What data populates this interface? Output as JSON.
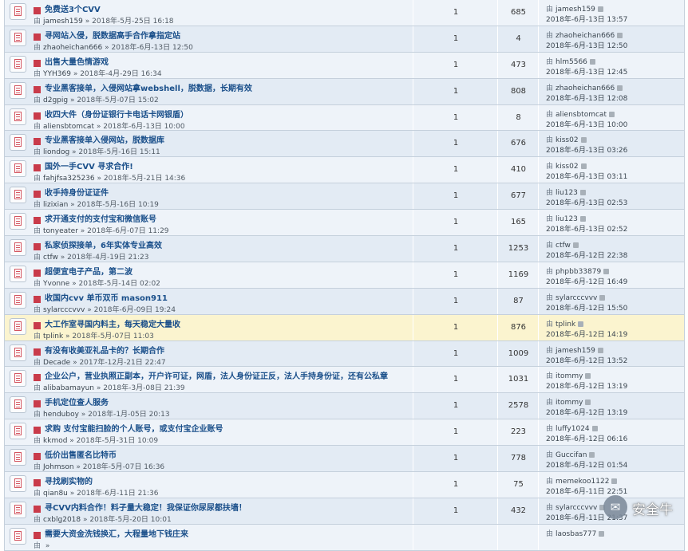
{
  "icons": {
    "topic": "topic-doc-icon",
    "bullet": "red-square-icon",
    "author": "author-icon",
    "last_author": "author-icon",
    "goto_last": "goto-last-post-icon"
  },
  "colors": {
    "title": "#1a4f8a",
    "row": "#eef3f9",
    "row_alt": "#e3ebf4",
    "row_sticky": "#fbf4cf",
    "bullet": "#c93b4a"
  },
  "author_marker": "由",
  "topics": [
    {
      "title": "免费送3个CVV",
      "author": "jamesh159",
      "date": "2018年-5月-25日 16:18",
      "replies": "1",
      "views": "685",
      "last_author": "jamesh159",
      "last_date": "2018年-6月-13日 13:57"
    },
    {
      "title": "寻网站入侵，脱数据高手合作拿指定站",
      "author": "zhaoheichan666",
      "date": "2018年-6月-13日 12:50",
      "replies": "1",
      "views": "4",
      "last_author": "zhaoheichan666",
      "last_date": "2018年-6月-13日 12:50"
    },
    {
      "title": "出售大量色情游戏",
      "author": "YYH369",
      "date": "2018年-4月-29日 16:34",
      "replies": "1",
      "views": "473",
      "last_author": "hlm5566",
      "last_date": "2018年-6月-13日 12:45"
    },
    {
      "title": "专业黑客接单，入侵网站拿webshell，脱数据，长期有效",
      "author": "d2gpig",
      "date": "2018年-5月-07日 15:02",
      "replies": "1",
      "views": "808",
      "last_author": "zhaoheichan666",
      "last_date": "2018年-6月-13日 12:08"
    },
    {
      "title": "收四大件（身份证银行卡电话卡网银盾）",
      "author": "aliensbtomcat",
      "date": "2018年-6月-13日 10:00",
      "replies": "1",
      "views": "8",
      "last_author": "aliensbtomcat",
      "last_date": "2018年-6月-13日 10:00"
    },
    {
      "title": "专业黑客接单入侵网站，脱数据库",
      "author": "liondog",
      "date": "2018年-5月-16日 15:11",
      "replies": "1",
      "views": "676",
      "last_author": "kiss02",
      "last_date": "2018年-6月-13日 03:26"
    },
    {
      "title": "国外一手CVV 寻求合作!",
      "author": "fahjfsa325236",
      "date": "2018年-5月-21日 14:36",
      "replies": "1",
      "views": "410",
      "last_author": "kiss02",
      "last_date": "2018年-6月-13日 03:11"
    },
    {
      "title": "收手持身份证证件",
      "author": "lizixian",
      "date": "2018年-5月-16日 10:19",
      "replies": "1",
      "views": "677",
      "last_author": "liu123",
      "last_date": "2018年-6月-13日 02:53"
    },
    {
      "title": "求开通支付的支付宝和微信账号",
      "author": "tonyeater",
      "date": "2018年-6月-07日 11:29",
      "replies": "1",
      "views": "165",
      "last_author": "liu123",
      "last_date": "2018年-6月-13日 02:52"
    },
    {
      "title": "私家侦探接单，6年实体专业高效",
      "author": "ctfw",
      "date": "2018年-4月-19日 21:23",
      "replies": "1",
      "views": "1253",
      "last_author": "ctfw",
      "last_date": "2018年-6月-12日 22:38"
    },
    {
      "title": "超便宜电子产品，第二波",
      "author": "Yvonne",
      "date": "2018年-5月-14日 02:02",
      "replies": "1",
      "views": "1169",
      "last_author": "phpbb33879",
      "last_date": "2018年-6月-12日 16:49"
    },
    {
      "title": "收国内cvv 单币双币 mason911",
      "author": "sylarcccvvv",
      "date": "2018年-6月-09日 19:24",
      "replies": "1",
      "views": "87",
      "last_author": "sylarcccvvv",
      "last_date": "2018年-6月-12日 15:50"
    },
    {
      "title": "大工作室寻国内料主，每天稳定大量收",
      "author": "tplink",
      "date": "2018年-5月-07日 11:03",
      "replies": "1",
      "views": "876",
      "last_author": "tplink",
      "last_date": "2018年-6月-12日 14:19",
      "sticky": true
    },
    {
      "title": "有没有收美亚礼品卡的？长期合作",
      "author": "Decade",
      "date": "2017年-12月-21日 22:47",
      "replies": "1",
      "views": "1009",
      "last_author": "jamesh159",
      "last_date": "2018年-6月-12日 13:52"
    },
    {
      "title": "企业公户，营业执照正副本，开户许可证，网盾，法人身份证正反，法人手持身份证，还有公私章",
      "author": "alibabamayun",
      "date": "2018年-3月-08日 21:39",
      "replies": "1",
      "views": "1031",
      "last_author": "itommy",
      "last_date": "2018年-6月-12日 13:19"
    },
    {
      "title": "手机定位查人服务",
      "author": "henduboy",
      "date": "2018年-1月-05日 20:13",
      "replies": "1",
      "views": "2578",
      "last_author": "itommy",
      "last_date": "2018年-6月-12日 13:19"
    },
    {
      "title": "求购 支付宝能扫脸的个人账号，或支付宝企业账号",
      "author": "kkmod",
      "date": "2018年-5月-31日 10:09",
      "replies": "1",
      "views": "223",
      "last_author": "luffy1024",
      "last_date": "2018年-6月-12日 06:16"
    },
    {
      "title": "低价出售匿名比特币",
      "author": "Johmson",
      "date": "2018年-5月-07日 16:36",
      "replies": "1",
      "views": "778",
      "last_author": "Guccifan",
      "last_date": "2018年-6月-12日 01:54"
    },
    {
      "title": "寻找刷实物的",
      "author": "qian8u",
      "date": "2018年-6月-11日 21:36",
      "replies": "1",
      "views": "75",
      "last_author": "memekoo1122",
      "last_date": "2018年-6月-11日 22:51"
    },
    {
      "title": "寻CVV内料合作！料子量大稳定！我保证你尿尿都扶墙！",
      "author": "cxblg2018",
      "date": "2018年-5月-20日 10:01",
      "replies": "1",
      "views": "432",
      "last_author": "sylarcccvvv",
      "last_date": "2018年-6月-11日 21:37"
    },
    {
      "title": "需要大资金洗钱换汇，大程量地下钱庄来",
      "author": "",
      "date": "",
      "replies": "",
      "views": "",
      "last_author": "laosbas777",
      "last_date": ""
    }
  ],
  "watermark": {
    "icon": "wechat-icon",
    "text": "安全牛"
  }
}
